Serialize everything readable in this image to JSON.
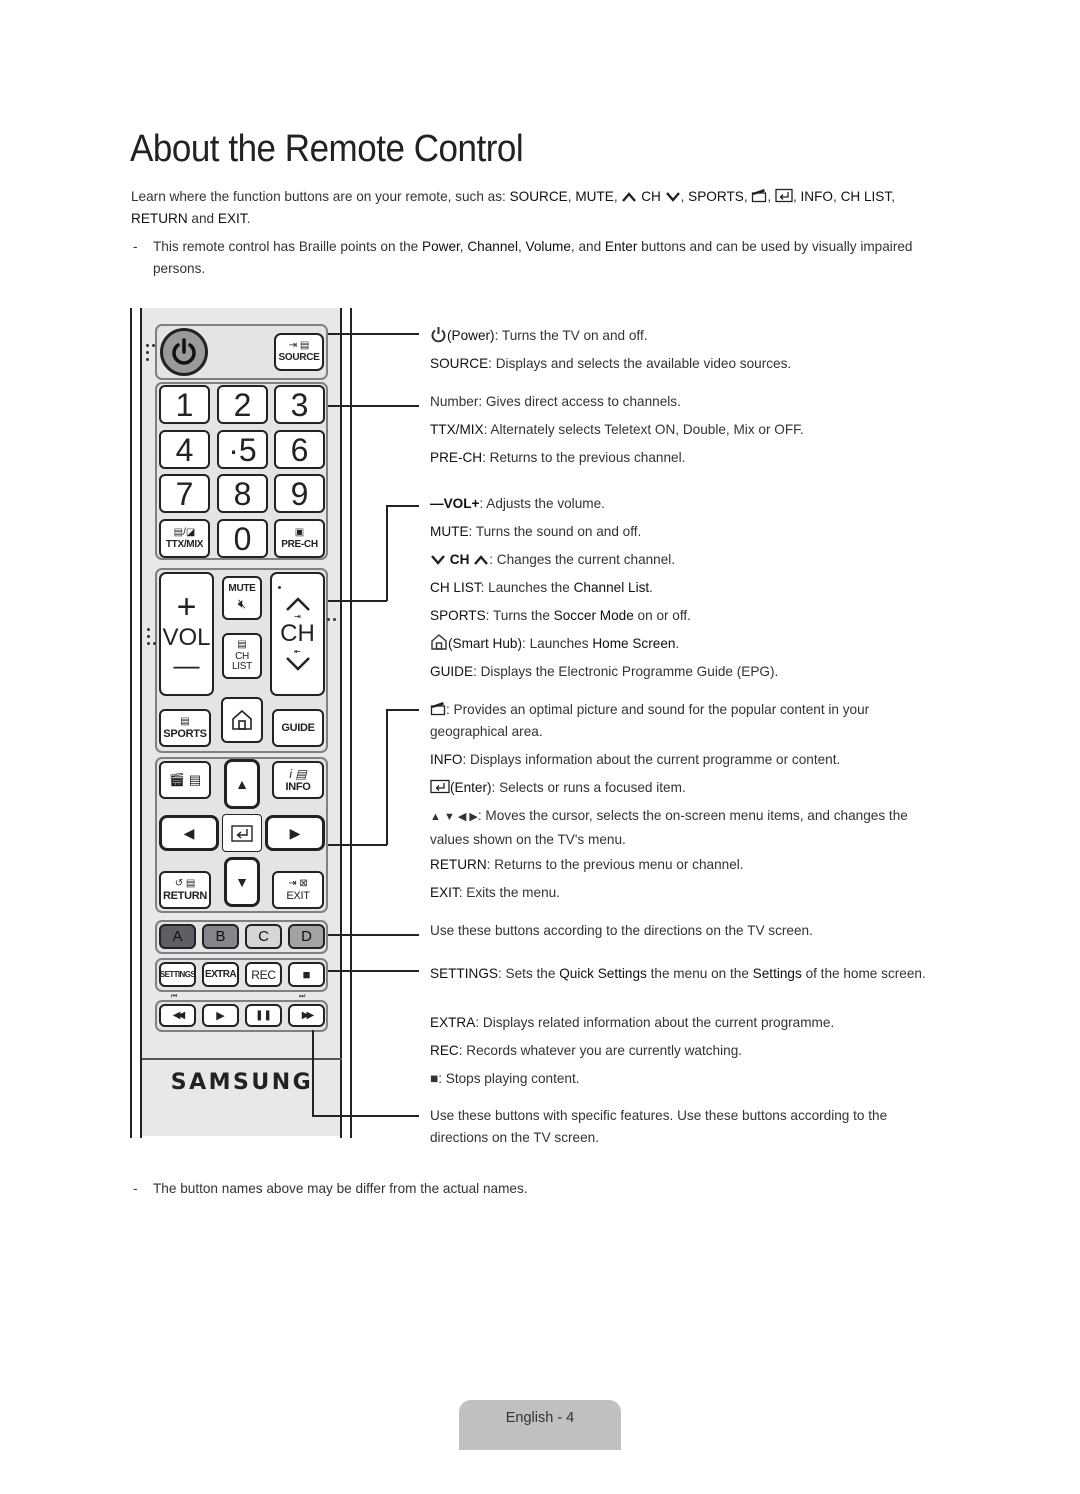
{
  "page": {
    "title": "About the Remote Control",
    "intro": {
      "prefix": "Learn where the function buttons are on your remote, such as: ",
      "items": [
        "SOURCE",
        "MUTE",
        "CH",
        "SPORTS",
        "INFO",
        "CH LIST",
        "RETURN",
        "EXIT"
      ],
      "sep1": ", ",
      "and": " and ",
      "period": "."
    },
    "braille_note": {
      "dash": "-",
      "text_a": "This remote control has Braille points on the ",
      "power": "Power",
      "channel": "Channel",
      "volume": "Volume",
      "and": ", and ",
      "enter": "Enter",
      "text_b": " buttons and can be used by visually impaired persons."
    },
    "footer_note": {
      "dash": "-",
      "text": "The button names above may be differ from the actual names."
    },
    "page_label": "English - 4"
  },
  "remote": {
    "source_label": "SOURCE",
    "digits": [
      "1",
      "2",
      "3",
      "4",
      "·5",
      "6",
      "7",
      "8",
      "9",
      "0"
    ],
    "ttx_label": "TTX/MIX",
    "prech_label": "PRE-CH",
    "vol_label": "VOL",
    "vol_plus": "+",
    "vol_minus": "—",
    "mute_label": "MUTE",
    "ch_label": "CH",
    "chlist_line1": "CH",
    "chlist_line2": "LIST",
    "sports_label": "SPORTS",
    "guide_label": "GUIDE",
    "info_label": "INFO",
    "return_label": "RETURN",
    "exit_label": "EXIT",
    "color_buttons": [
      {
        "label": "A",
        "color": "#5f5f63"
      },
      {
        "label": "B",
        "color": "#86868a"
      },
      {
        "label": "C",
        "color": "#d6d6d6"
      },
      {
        "label": "D",
        "color": "#a3a3a6"
      }
    ],
    "row_settings": [
      "SETTINGS",
      "EXTRA",
      "REC",
      "■"
    ],
    "row_playback": [
      "◀◀",
      "▶",
      "❚❚",
      "▶▶"
    ],
    "brand": "SAMSUNG"
  },
  "descriptions": {
    "power": {
      "name": "(Power)",
      "text": ": Turns the TV on and off."
    },
    "source": {
      "name": "SOURCE",
      "text": ": Displays and selects the available video sources."
    },
    "number": {
      "name": "Number",
      "text": ": Gives direct access to channels."
    },
    "ttx": {
      "name": "TTX/MIX",
      "text": ": Alternately selects Teletext ON, Double, Mix or OFF."
    },
    "prech": {
      "name": "PRE-CH",
      "text": ": Returns to the previous channel."
    },
    "vol": {
      "name": "—VOL+",
      "text": ": Adjusts the volume."
    },
    "mute": {
      "name": "MUTE",
      "text": ": Turns the sound on and off."
    },
    "ch": {
      "name": "CH",
      "text": ": Changes the current channel."
    },
    "chlist": {
      "name": "CH LIST",
      "text_a": ": Launches the ",
      "bold": "Channel List",
      "text_b": "."
    },
    "sports": {
      "name": "SPORTS",
      "text_a": ": Turns the ",
      "bold": "Soccer Mode",
      "text_b": " on or off."
    },
    "smarthub": {
      "name": "(Smart Hub)",
      "text_a": ": Launches ",
      "bold": "Home Screen",
      "text_b": "."
    },
    "guide": {
      "name": "GUIDE",
      "text": ": Displays the Electronic Programme Guide (EPG)."
    },
    "optimal": {
      "text": ": Provides an optimal picture and sound for the popular content in your geographical area."
    },
    "info": {
      "name": "INFO",
      "text": ": Displays information about the current programme or content."
    },
    "enter": {
      "name": "(Enter)",
      "text": ": Selects or runs a focused item."
    },
    "arrows": {
      "glyphs": "▲ ▼ ◀ ▶",
      "text": ": Moves the cursor, selects the on-screen menu items, and changes the values shown on the TV's menu."
    },
    "return": {
      "name": "RETURN",
      "text": ": Returns to the previous menu or channel."
    },
    "exit": {
      "name": "EXIT",
      "text": ": Exits the menu."
    },
    "colors": {
      "text": "Use these buttons according to the directions on the TV screen."
    },
    "settings": {
      "name": "SETTINGS",
      "text_a": ": Sets the ",
      "bold1": "Quick Settings",
      "text_b": " the menu on the ",
      "bold2": "Settings",
      "text_c": " of the home screen."
    },
    "extra": {
      "name": "EXTRA",
      "text": ": Displays related information about the current programme."
    },
    "rec": {
      "name": "REC",
      "text": ": Records whatever you are currently watching."
    },
    "stop": {
      "glyph": "■",
      "text": ": Stops playing content."
    },
    "playback": {
      "text": "Use these buttons with specific features. Use these buttons according to the directions on the TV screen."
    }
  }
}
